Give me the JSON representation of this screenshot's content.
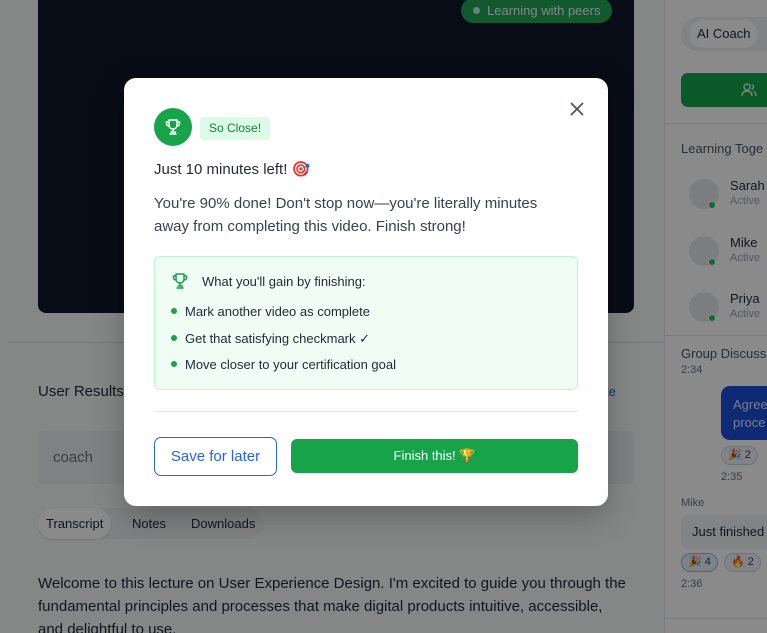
{
  "background": {
    "video_badge": "Learning with peers",
    "results_title": "User Results",
    "results_link": "te",
    "search_value": "coach",
    "tabs": [
      "Transcript",
      "Notes",
      "Downloads"
    ],
    "lecture_text": "Welcome to this lecture on User Experience Design. I'm excited to guide you through the fundamental principles and processes that make digital products intuitive, accessible, and delightful to use."
  },
  "right_panel": {
    "tab_ai_coach": "AI Coach",
    "learning_together_title": "Learning Toge",
    "peers": [
      {
        "name": "Sarah",
        "status": "Active"
      },
      {
        "name": "Mike",
        "status": "Active"
      },
      {
        "name": "Priya",
        "status": "Active"
      }
    ],
    "group_discussion_title": "Group Discuss",
    "chat": {
      "time_top": "2:34",
      "blue_bubble_text": "Agree proce",
      "reaction_1": "🎉 2",
      "time_1": "2:35",
      "author": "Mike",
      "gray_bubble_text": "Just finished",
      "reaction_2": "🎉 4",
      "reaction_3": "🔥 2",
      "time_2": "2:36"
    }
  },
  "modal": {
    "badge": "So Close!",
    "title": "Just 10 minutes left! 🎯",
    "body": "You're 90% done! Don't stop now—you're literally minutes away from completing this video. Finish strong!",
    "gain_title": "What you'll gain by finishing:",
    "gain_items": [
      "Mark another video as complete",
      "Get that satisfying checkmark ✓",
      "Move closer to your certification goal"
    ],
    "save_label": "Save for later",
    "finish_label": "Finish this! 🏆"
  },
  "colors": {
    "accent_green": "#16a34a",
    "link_blue": "#2563eb",
    "overlay": "rgba(0,0,0,0.46)"
  },
  "icons": {
    "modal_badge_icon": "trophy-icon",
    "gain_icon": "trophy-icon",
    "close": "close-icon",
    "group": "users-icon"
  }
}
